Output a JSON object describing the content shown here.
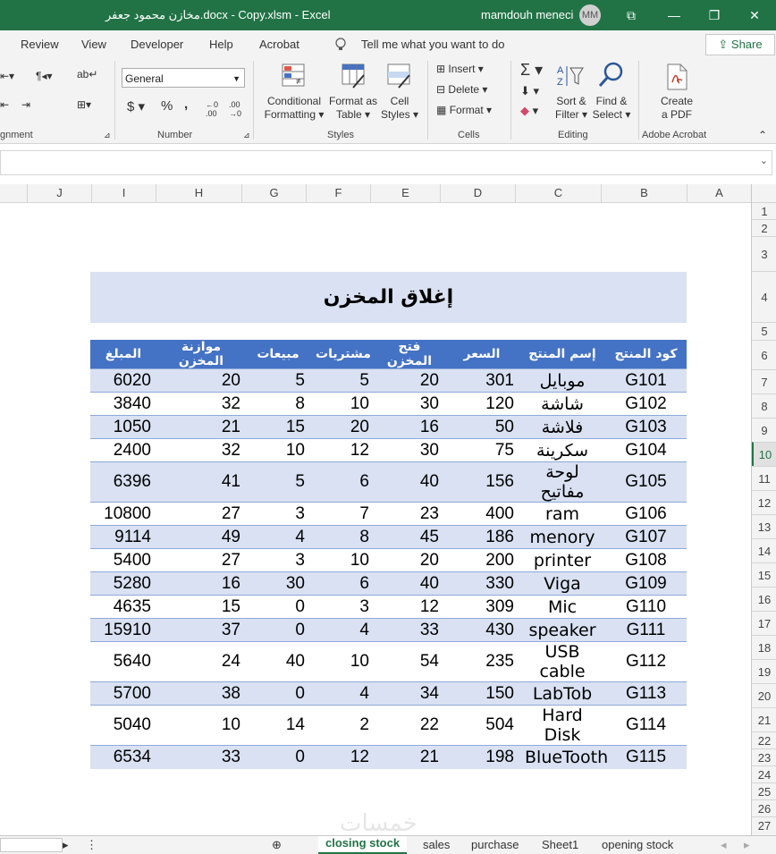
{
  "titlebar": {
    "title": "مخازن محمود جعفر.docx - Copy.xlsm  -  Excel",
    "user": "mamdouh meneci",
    "avatar": "MM",
    "buttons": [
      "⧉",
      "—",
      "❐",
      "✕"
    ]
  },
  "ribbon_tabs": [
    "Review",
    "View",
    "Developer",
    "Help",
    "Acrobat"
  ],
  "tell_me": "Tell me what you want to do",
  "share_label": "Share",
  "ribbon": {
    "alignment_label": "gnment",
    "number": {
      "format": "General",
      "label": "Number",
      "currency": "$",
      "percent": "%",
      "comma": ","
    },
    "styles": {
      "cond_line1": "Conditional",
      "cond_line2": "Formatting",
      "table_line1": "Format as",
      "table_line2": "Table",
      "cell_line1": "Cell",
      "cell_line2": "Styles",
      "label": "Styles"
    },
    "cells": {
      "insert": "Insert",
      "delete": "Delete",
      "format": "Format",
      "label": "Cells"
    },
    "editing": {
      "sort_line1": "Sort &",
      "sort_line2": "Filter",
      "find_line1": "Find &",
      "find_line2": "Select",
      "label": "Editing"
    },
    "acrobat": {
      "line1": "Create",
      "line2": "a PDF",
      "label": "Adobe Acrobat"
    }
  },
  "columns": [
    "J",
    "I",
    "H",
    "G",
    "F",
    "E",
    "D",
    "C",
    "B",
    "A"
  ],
  "rows": [
    "1",
    "2",
    "3",
    "4",
    "5",
    "6",
    "7",
    "8",
    "9",
    "10",
    "11",
    "12",
    "13",
    "14",
    "15",
    "16",
    "17",
    "18",
    "19",
    "20",
    "21",
    "22",
    "23",
    "24",
    "25",
    "26",
    "27"
  ],
  "sheet_title": "إغلاق المخزن",
  "table": {
    "headers": [
      "المبلغ",
      "موازنة المخزن",
      "مبيعات",
      "مشتريات",
      "فتح المخزن",
      "السعر",
      "إسم المنتج",
      "كود المنتج"
    ],
    "rows": [
      [
        "6020",
        "20",
        "5",
        "5",
        "20",
        "301",
        "موبايل",
        "G101"
      ],
      [
        "3840",
        "32",
        "8",
        "10",
        "30",
        "120",
        "شاشة",
        "G102"
      ],
      [
        "1050",
        "21",
        "15",
        "20",
        "16",
        "50",
        "فلاشة",
        "G103"
      ],
      [
        "2400",
        "32",
        "10",
        "12",
        "30",
        "75",
        "سكرينة",
        "G104"
      ],
      [
        "6396",
        "41",
        "5",
        "6",
        "40",
        "156",
        "لوحة مفاتيح",
        "G105"
      ],
      [
        "10800",
        "27",
        "3",
        "7",
        "23",
        "400",
        "ram",
        "G106"
      ],
      [
        "9114",
        "49",
        "4",
        "8",
        "45",
        "186",
        "menory",
        "G107"
      ],
      [
        "5400",
        "27",
        "3",
        "10",
        "20",
        "200",
        "printer",
        "G108"
      ],
      [
        "5280",
        "16",
        "30",
        "6",
        "40",
        "330",
        "Viga",
        "G109"
      ],
      [
        "4635",
        "15",
        "0",
        "3",
        "12",
        "309",
        "Mic",
        "G110"
      ],
      [
        "15910",
        "37",
        "0",
        "4",
        "33",
        "430",
        "speaker",
        "G111"
      ],
      [
        "5640",
        "24",
        "40",
        "10",
        "54",
        "235",
        "USB cable",
        "G112"
      ],
      [
        "5700",
        "38",
        "0",
        "4",
        "34",
        "150",
        "LabTob",
        "G113"
      ],
      [
        "5040",
        "10",
        "14",
        "2",
        "22",
        "504",
        "Hard Disk",
        "G114"
      ],
      [
        "6534",
        "33",
        "0",
        "12",
        "21",
        "198",
        "BlueTooth",
        "G115"
      ]
    ]
  },
  "sheet_tabs": [
    "closing stock",
    "sales",
    "purchase",
    "Sheet1",
    "opening stock"
  ],
  "active_sheet": "closing stock",
  "watermark": "خمسات"
}
